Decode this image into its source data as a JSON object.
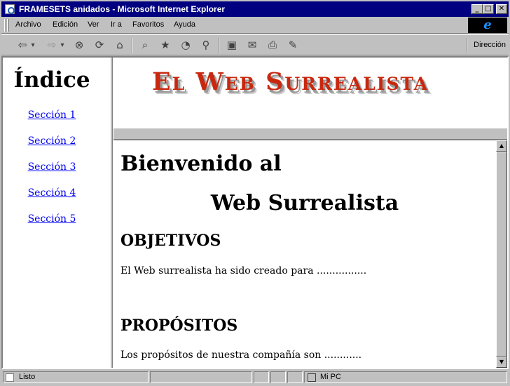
{
  "window": {
    "title": "FRAMESETS anidados - Microsoft Internet Explorer",
    "minimize_glyph": "_",
    "maximize_glyph": "□",
    "close_glyph": "✕"
  },
  "menubar": {
    "items": [
      "Archivo",
      "Edición",
      "Ver",
      "Ir a",
      "Favoritos",
      "Ayuda"
    ]
  },
  "ie_logo": {
    "glyph": "e",
    "icon": "internet-explorer-logo"
  },
  "toolbar": {
    "buttons": [
      {
        "name": "back",
        "glyph": "⇦",
        "icon": "back-arrow-icon"
      },
      {
        "name": "back-dropdown",
        "glyph": "▾",
        "icon": "chevron-down-icon"
      },
      {
        "name": "forward",
        "glyph": "⇨",
        "icon": "forward-arrow-icon"
      },
      {
        "name": "forward-dropdown",
        "glyph": "▾",
        "icon": "chevron-down-icon"
      },
      {
        "name": "stop",
        "glyph": "⊗",
        "icon": "stop-icon"
      },
      {
        "name": "refresh",
        "glyph": "⟳",
        "icon": "refresh-icon"
      },
      {
        "name": "home",
        "glyph": "⌂",
        "icon": "home-icon"
      },
      {
        "name": "search",
        "glyph": "⌕",
        "icon": "search-icon"
      },
      {
        "name": "favorites",
        "glyph": "★",
        "icon": "favorites-icon"
      },
      {
        "name": "history",
        "glyph": "◔",
        "icon": "history-icon"
      },
      {
        "name": "channels",
        "glyph": "⚲",
        "icon": "channels-icon"
      },
      {
        "name": "fullscreen",
        "glyph": "▣",
        "icon": "fullscreen-icon"
      },
      {
        "name": "mail",
        "glyph": "✉",
        "icon": "mail-icon"
      },
      {
        "name": "print",
        "glyph": "⎙",
        "icon": "print-icon"
      },
      {
        "name": "edit",
        "glyph": "✎",
        "icon": "edit-icon"
      }
    ],
    "address_label": "Dirección"
  },
  "left_frame": {
    "title": "Índice",
    "links": [
      "Sección 1",
      "Sección 2",
      "Sección 3",
      "Sección 4",
      "Sección 5"
    ]
  },
  "top_frame": {
    "logo_text": "El Web Surrealista"
  },
  "main_frame": {
    "heading_line1": "Bienvenido al",
    "heading_line2": "Web Surrealista",
    "sections": [
      {
        "title": "OBJETIVOS",
        "text": "El Web surrealista ha sido creado para ................"
      },
      {
        "title": "PROPÓSITOS",
        "text": "Los propósitos de nuestra compañía son ............"
      }
    ]
  },
  "scrollbar": {
    "up_glyph": "▲",
    "down_glyph": "▼"
  },
  "statusbar": {
    "status": "Listo",
    "zone": "Mi PC"
  },
  "colors": {
    "titlebar": "#000080",
    "chrome": "#c0c0c0",
    "link": "#0000ee",
    "logo": "#c8280f"
  }
}
